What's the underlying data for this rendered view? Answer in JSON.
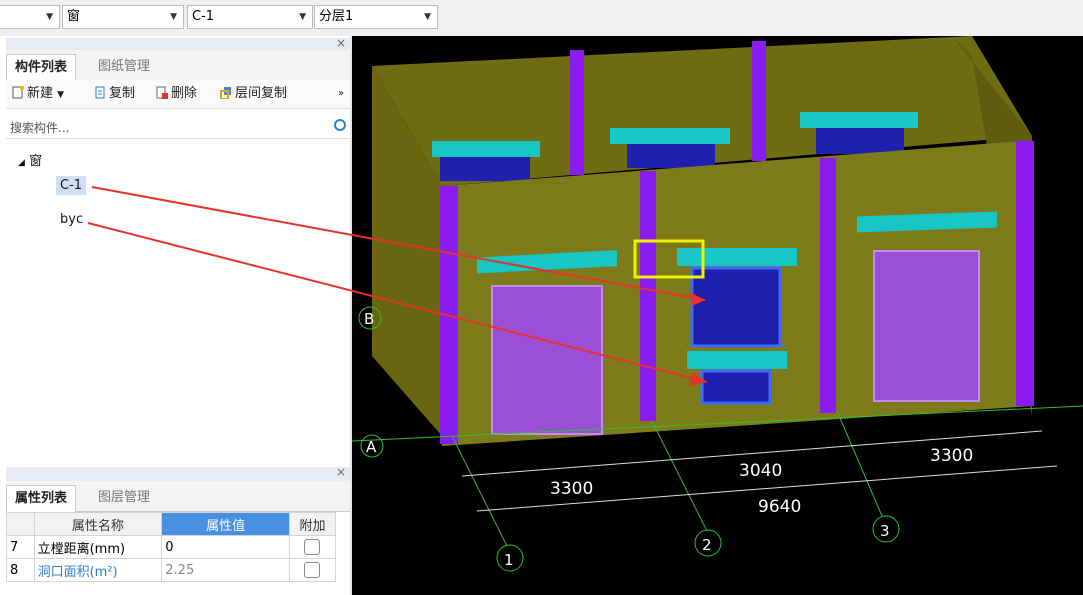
{
  "toolbar_top": {
    "dropdowns": [
      {
        "value": ""
      },
      {
        "value": "窗"
      },
      {
        "value": "C-1"
      },
      {
        "value": "分层1"
      }
    ]
  },
  "component_panel": {
    "tabs": [
      "构件列表",
      "图纸管理"
    ],
    "actions": {
      "new": "新建",
      "copy": "复制",
      "delete": "删除",
      "floor_copy": "层间复制"
    },
    "search_placeholder": "搜索构件...",
    "tree": {
      "root": "窗",
      "items": [
        "C-1",
        "byc"
      ]
    }
  },
  "property_panel": {
    "tabs": [
      "属性列表",
      "图层管理"
    ],
    "columns": [
      "",
      "属性名称",
      "属性值",
      "附加"
    ],
    "rows": [
      {
        "num": "7",
        "name": "立樘距离(mm)",
        "value": "0"
      },
      {
        "num": "8",
        "name": "洞口面积(m²)",
        "value": "2.25"
      }
    ]
  },
  "viewport": {
    "axis_labels": [
      "B",
      "A",
      "1",
      "2",
      "3"
    ],
    "dimensions": [
      "3300",
      "3040",
      "3300",
      "9640"
    ],
    "colors": {
      "wall": "#7d7a19",
      "column": "#8b1cf0",
      "lintel": "#19c6c6",
      "window": "#1f1fb0",
      "door": "#9b4fd6",
      "arrow": "#e63228",
      "highlight": "#f0f000",
      "grid": "#2fbf2f"
    }
  }
}
